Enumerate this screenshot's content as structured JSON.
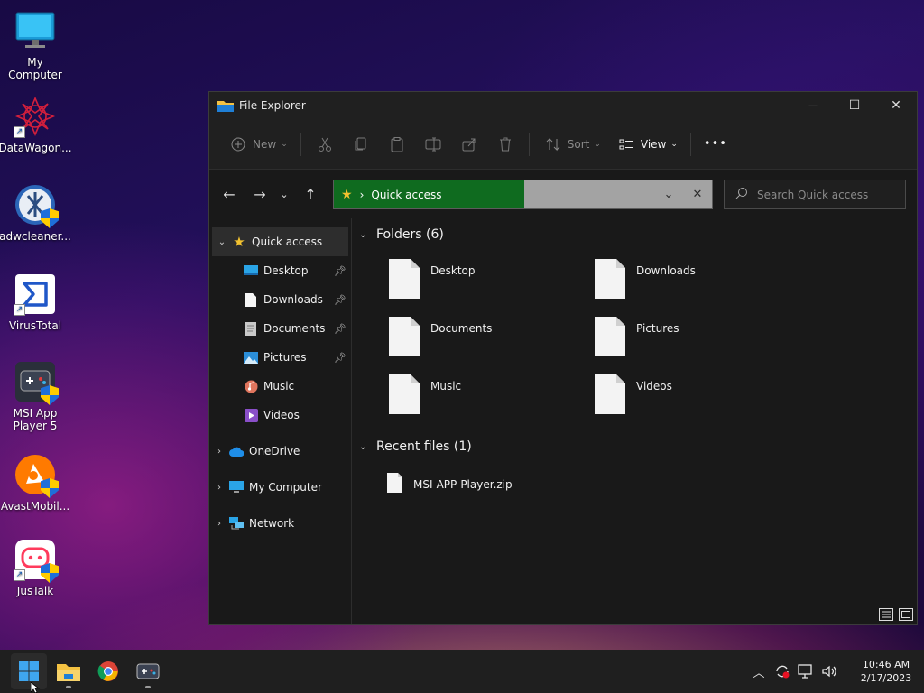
{
  "desktop": {
    "icons": [
      {
        "label": "My Computer"
      },
      {
        "label": "DataWagon..."
      },
      {
        "label": "adwcleaner..."
      },
      {
        "label": "VirusTotal"
      },
      {
        "label": "MSI App Player 5"
      },
      {
        "label": "AvastMobil..."
      },
      {
        "label": "JusTalk"
      }
    ]
  },
  "window": {
    "title": "File Explorer",
    "controls": {
      "minimize": "—",
      "maximize": "☐",
      "close": "✕"
    }
  },
  "toolbar": {
    "new_label": "New",
    "sort_label": "Sort",
    "view_label": "View",
    "more_label": "•••"
  },
  "nav": {
    "address_label": "Quick access",
    "search_placeholder": "Search Quick access"
  },
  "sidebar": {
    "quick_access": "Quick access",
    "items": [
      {
        "label": "Desktop",
        "pinned": true
      },
      {
        "label": "Downloads",
        "pinned": true
      },
      {
        "label": "Documents",
        "pinned": true
      },
      {
        "label": "Pictures",
        "pinned": true
      },
      {
        "label": "Music",
        "pinned": false
      },
      {
        "label": "Videos",
        "pinned": false
      }
    ],
    "onedrive": "OneDrive",
    "my_computer": "My Computer",
    "network": "Network"
  },
  "content": {
    "folders_header": "Folders (6)",
    "folders": [
      "Desktop",
      "Downloads",
      "Documents",
      "Pictures",
      "Music",
      "Videos"
    ],
    "recent_header": "Recent files (1)",
    "recent_files": [
      "MSI-APP-Player.zip"
    ]
  },
  "taskbar": {
    "time": "10:46 AM",
    "date": "2/17/2023"
  },
  "colors": {
    "address_crumb_bg": "#0f6b1f",
    "window_bg": "#191919",
    "taskbar_bg": "#1f1f1f",
    "accent": "#0078d4"
  }
}
